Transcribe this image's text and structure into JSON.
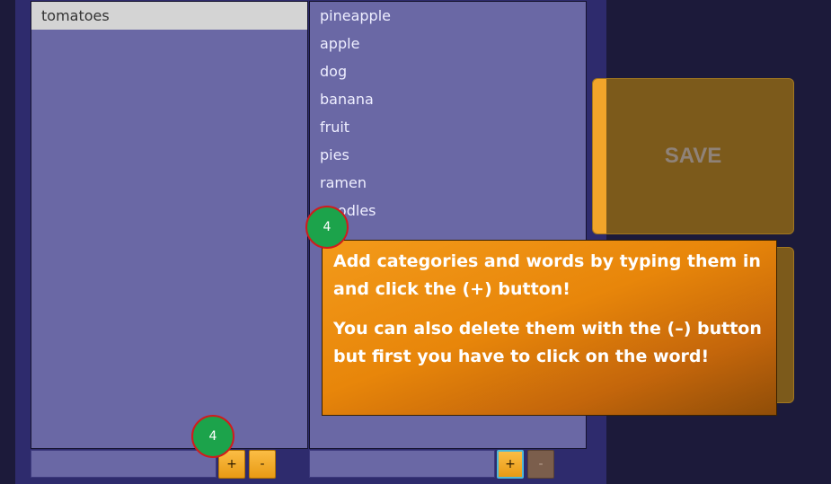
{
  "categories": {
    "items": [
      "tomatoes"
    ],
    "selected_index": 0
  },
  "words": {
    "items": [
      "pineapple",
      "apple",
      "dog",
      "banana",
      "fruit",
      "pies",
      "ramen",
      "noodles"
    ]
  },
  "buttons": {
    "add": "+",
    "remove": "-",
    "save": "SAVE"
  },
  "tutorial": {
    "step": "4",
    "line1": "Add categories and words by typing them in and click the (+) button!",
    "line2": "You can also delete them with the (–) button but first you have to click on the word!"
  },
  "colors": {
    "panel": "#2e2b6d",
    "list": "#6a68a5",
    "accent": "#f2a52a",
    "marker": "#1ca34b"
  }
}
